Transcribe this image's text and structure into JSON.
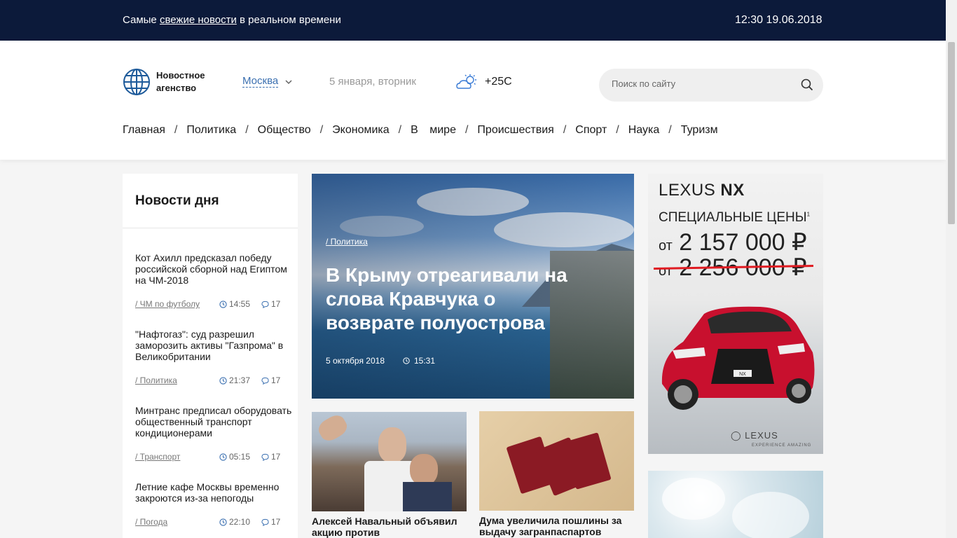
{
  "topbar": {
    "tagline_pre": "Самые ",
    "tagline_link": "свежие новости",
    "tagline_post": " в реальном времени",
    "datetime": "12:30 19.06.2018"
  },
  "header": {
    "logo_line1": "Новостное",
    "logo_line2": "агенство",
    "city": "Москва",
    "date": "5 января, вторник",
    "weather_icon": "partly-cloudy-icon",
    "temperature": "+25C",
    "search_placeholder": "Поиск по сайту"
  },
  "nav": {
    "items": [
      "Главная",
      "Политика",
      "Общество",
      "Экономика",
      "В мире",
      "Происшествия",
      "Спорт",
      "Наука",
      "Туризм"
    ],
    "separator": "/"
  },
  "sidebar": {
    "title": "Новости дня",
    "items": [
      {
        "title": "Кот Ахилл предсказал победу российской сборной над Египтом на ЧМ-2018",
        "category": "/ ЧМ по футболу",
        "time": "14:55",
        "comments": "17"
      },
      {
        "title": "\"Нафтогаз\": суд разрешил заморозить активы \"Газпрома\" в Великобритании",
        "category": "/ Политика",
        "time": "21:37",
        "comments": "17"
      },
      {
        "title": "Минтранс предписал оборудовать общественный транспорт кондиционерами",
        "category": "/ Транспорт",
        "time": "05:15",
        "comments": "17"
      },
      {
        "title": "Летние кафе Москвы временно закроются из-за непогоды",
        "category": "/ Погода",
        "time": "22:10",
        "comments": "17"
      }
    ]
  },
  "hero": {
    "category": "/ Политика",
    "title": "В Крыму отреагивали на слова Кравчука о возврате полуострова",
    "date": "5 октября 2018",
    "time": "15:31"
  },
  "cards": [
    {
      "title": "Алексей Навальный объявил акцию против"
    },
    {
      "title": "Дума увеличила пошлины за выдачу загранпаспартов"
    }
  ],
  "ad": {
    "brand_a": "LEXUS ",
    "brand_b": "NX",
    "line1": "СПЕЦИАЛЬНЫЕ ЦЕНЫ",
    "footnote": "1",
    "price_prefix": "от",
    "price_new": " 2 157 000 ₽",
    "price_old": " 2 256 000 ₽",
    "plate": "NX",
    "logo": "LEXUS",
    "slogan": "EXPERIENCE AMAZING"
  },
  "colors": {
    "topbar": "#0c1a3a",
    "accent": "#3a6fb0",
    "strike": "#e01b22"
  }
}
